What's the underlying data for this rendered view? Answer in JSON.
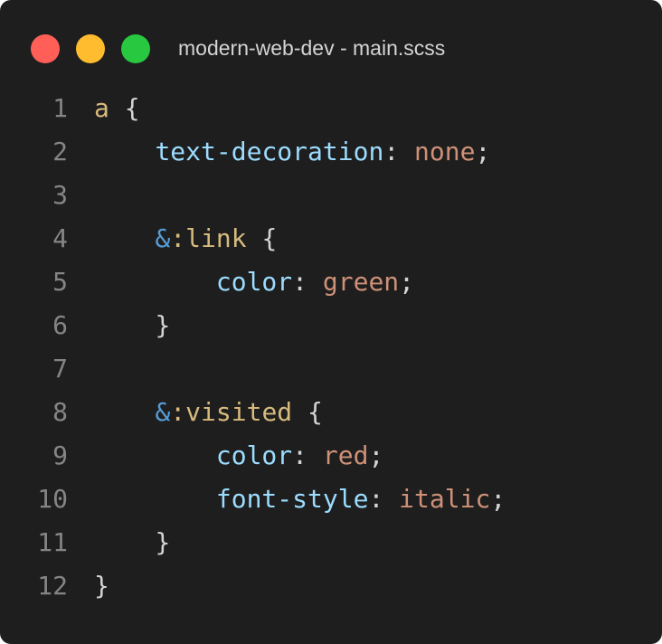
{
  "window": {
    "title": "modern-web-dev - main.scss",
    "controls": [
      {
        "name": "close",
        "color": "#ff5f57"
      },
      {
        "name": "minimize",
        "color": "#febc2e"
      },
      {
        "name": "maximize",
        "color": "#28c840"
      }
    ]
  },
  "colors": {
    "background": "#1e1e1e",
    "line_number": "#858585",
    "selector": "#d7ba7d",
    "property": "#9cdcfe",
    "value": "#ce9178",
    "punctuation": "#d4d4d4",
    "nesting": "#569cd6"
  },
  "code": {
    "lines": [
      {
        "number": "1",
        "indent": "",
        "tokens": [
          {
            "text": "a",
            "type": "selector"
          },
          {
            "text": " {",
            "type": "punctuation"
          }
        ]
      },
      {
        "number": "2",
        "indent": "    ",
        "tokens": [
          {
            "text": "text-decoration",
            "type": "property"
          },
          {
            "text": ": ",
            "type": "punctuation"
          },
          {
            "text": "none",
            "type": "value"
          },
          {
            "text": ";",
            "type": "punctuation"
          }
        ]
      },
      {
        "number": "3",
        "indent": "",
        "tokens": []
      },
      {
        "number": "4",
        "indent": "    ",
        "tokens": [
          {
            "text": "&",
            "type": "nesting"
          },
          {
            "text": ":link",
            "type": "selector"
          },
          {
            "text": " {",
            "type": "punctuation"
          }
        ]
      },
      {
        "number": "5",
        "indent": "        ",
        "tokens": [
          {
            "text": "color",
            "type": "property"
          },
          {
            "text": ": ",
            "type": "punctuation"
          },
          {
            "text": "green",
            "type": "value"
          },
          {
            "text": ";",
            "type": "punctuation"
          }
        ]
      },
      {
        "number": "6",
        "indent": "    ",
        "tokens": [
          {
            "text": "}",
            "type": "punctuation"
          }
        ]
      },
      {
        "number": "7",
        "indent": "",
        "tokens": []
      },
      {
        "number": "8",
        "indent": "    ",
        "tokens": [
          {
            "text": "&",
            "type": "nesting"
          },
          {
            "text": ":visited",
            "type": "selector"
          },
          {
            "text": " {",
            "type": "punctuation"
          }
        ]
      },
      {
        "number": "9",
        "indent": "        ",
        "tokens": [
          {
            "text": "color",
            "type": "property"
          },
          {
            "text": ": ",
            "type": "punctuation"
          },
          {
            "text": "red",
            "type": "value"
          },
          {
            "text": ";",
            "type": "punctuation"
          }
        ]
      },
      {
        "number": "10",
        "indent": "        ",
        "tokens": [
          {
            "text": "font-style",
            "type": "property"
          },
          {
            "text": ": ",
            "type": "punctuation"
          },
          {
            "text": "italic",
            "type": "value"
          },
          {
            "text": ";",
            "type": "punctuation"
          }
        ]
      },
      {
        "number": "11",
        "indent": "    ",
        "tokens": [
          {
            "text": "}",
            "type": "punctuation"
          }
        ]
      },
      {
        "number": "12",
        "indent": "",
        "tokens": [
          {
            "text": "}",
            "type": "punctuation"
          }
        ]
      }
    ]
  }
}
